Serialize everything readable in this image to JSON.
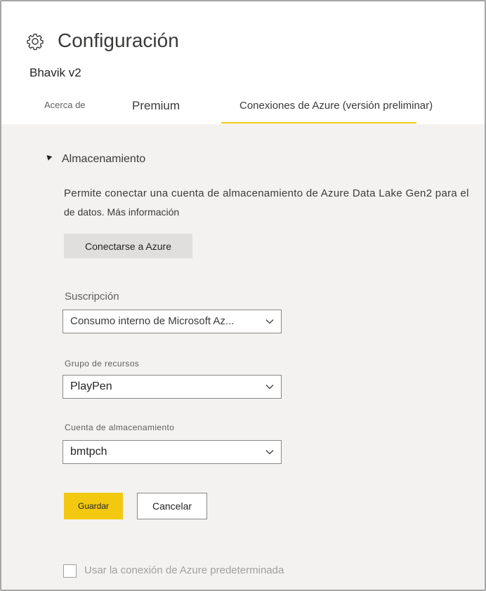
{
  "page": {
    "title": "Configuración",
    "subtitle": "Bhavik v2"
  },
  "tabs": {
    "about": "Acerca de",
    "premium": "Premium",
    "azure": "Conexiones de Azure (versión preliminar)",
    "active": "azure"
  },
  "storage": {
    "section_title": "Almacenamiento",
    "description_line1": "Permite conectar una cuenta de almacenamiento de Azure Data Lake Gen2 para el",
    "description_line2": "de datos.",
    "more_info_link": "Más información",
    "connect_button": "Conectarse a Azure",
    "subscription_label": "Suscripción",
    "subscription_value": "Consumo interno de Microsoft Az...",
    "resource_group_label": "Grupo de recursos",
    "resource_group_value": "PlayPen",
    "storage_account_label": "Cuenta de almacenamiento",
    "storage_account_value": "bmtpch",
    "save_button": "Guardar",
    "cancel_button": "Cancelar",
    "default_connection_label": "Usar la conexión de Azure predeterminada",
    "default_connection_checked": false
  },
  "icons": {
    "settings": "gear-icon",
    "collapse": "caret-down-icon",
    "dropdown": "chevron-down-icon"
  },
  "colors": {
    "accent": "#f2c811",
    "content_background": "#f3f2f1",
    "secondary_button": "#e1dfdd"
  }
}
